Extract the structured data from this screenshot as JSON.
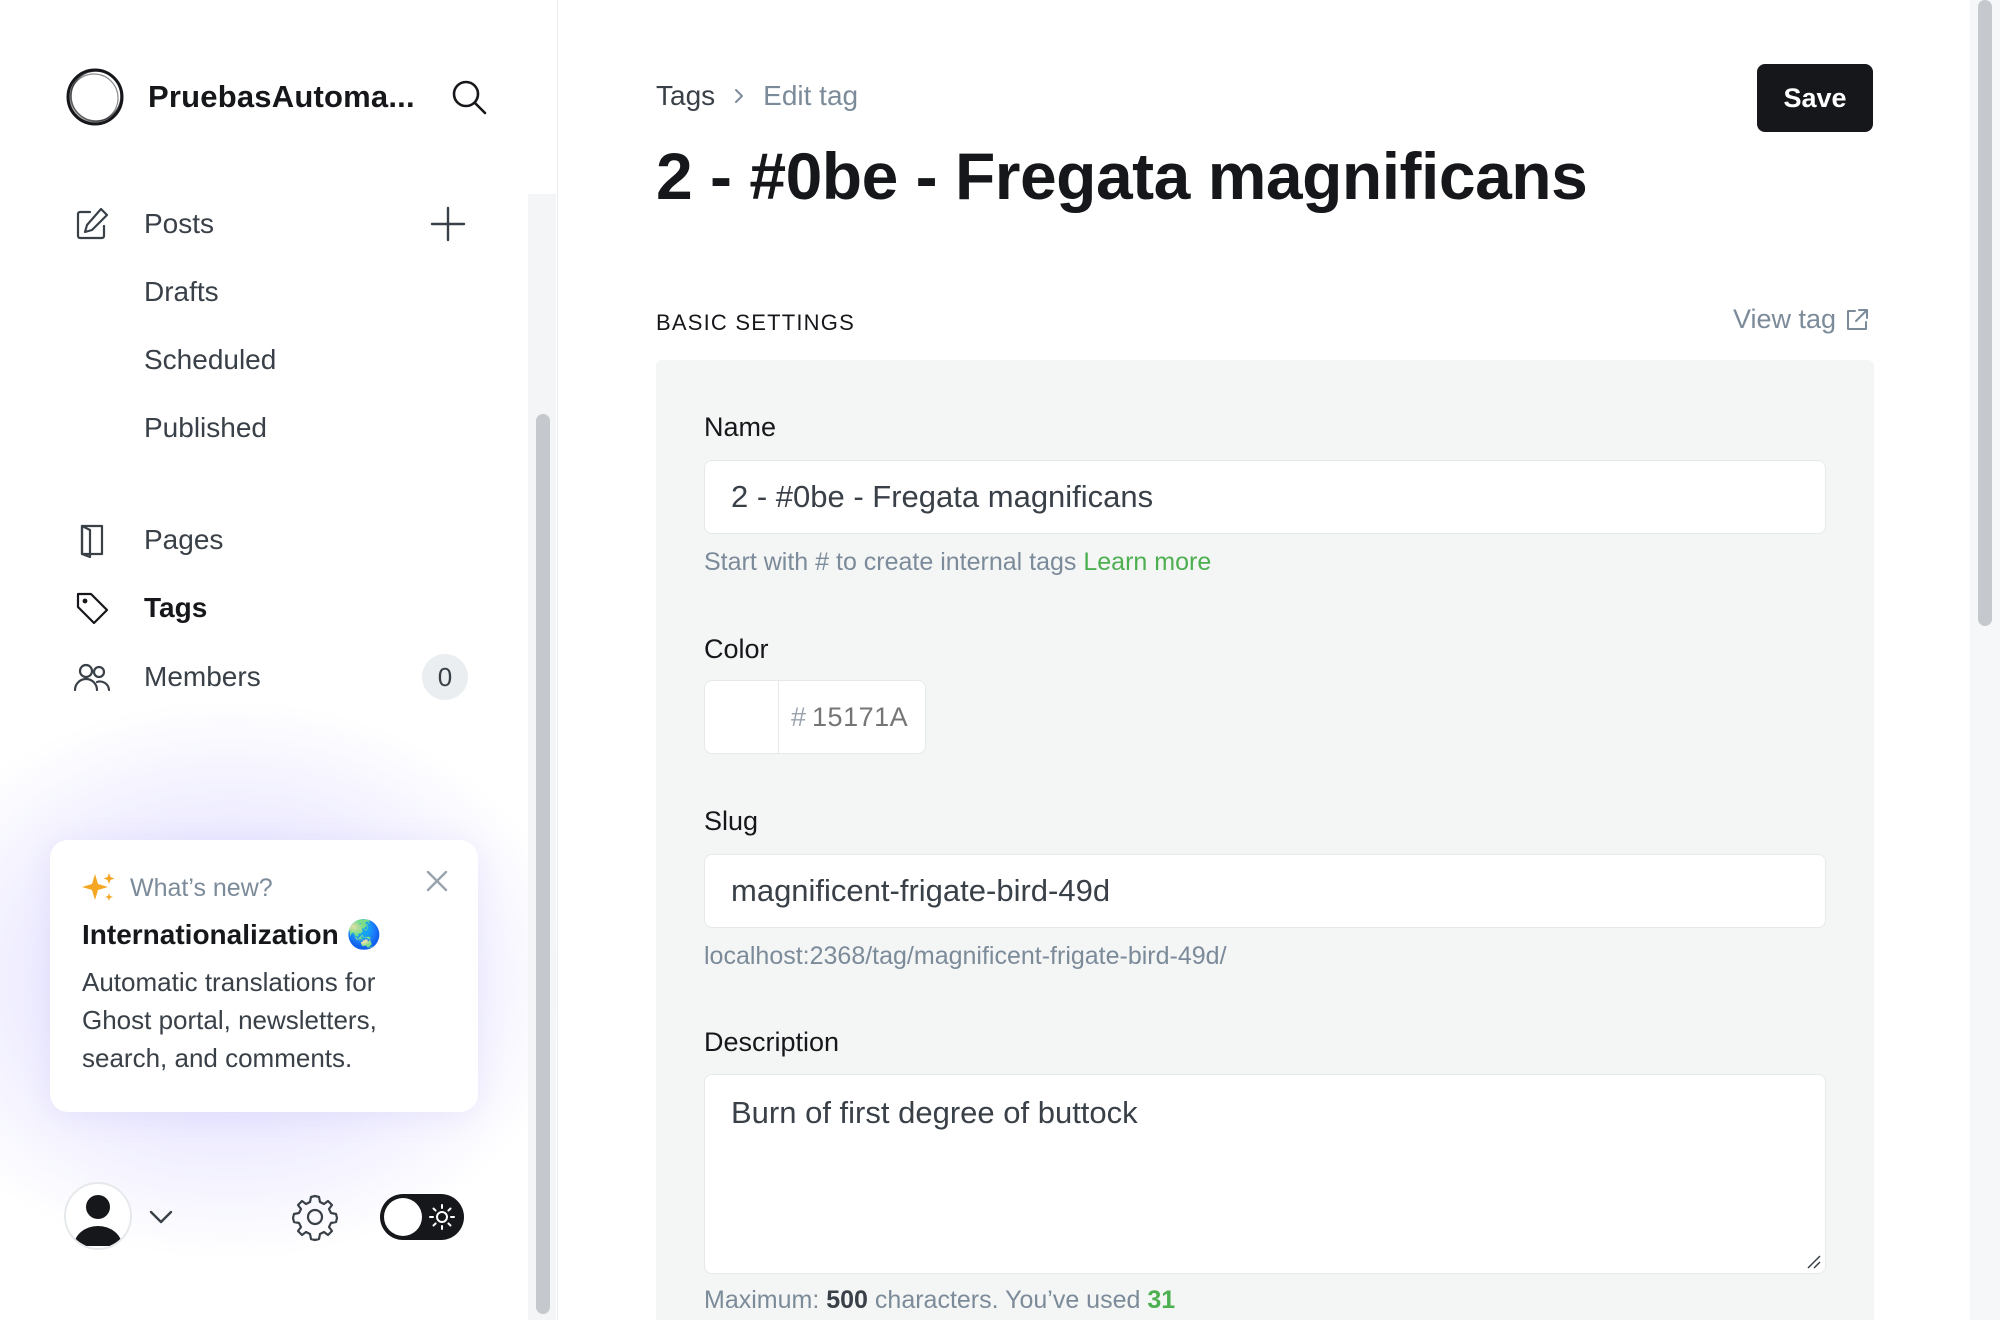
{
  "sidebar": {
    "site_title": "PruebasAutoma...",
    "nav": {
      "posts": "Posts",
      "drafts": "Drafts",
      "scheduled": "Scheduled",
      "published": "Published",
      "pages": "Pages",
      "tags": "Tags",
      "members": "Members",
      "members_count": "0"
    },
    "whats_new": {
      "kicker": "What’s new?",
      "title": "Internationalization 🌏",
      "body": "Automatic translations for Ghost portal, newsletters, search, and comments."
    }
  },
  "header": {
    "breadcrumb_parent": "Tags",
    "breadcrumb_current": "Edit tag",
    "save_label": "Save",
    "title": "2 - #0be - Fregata magnificans"
  },
  "basic_settings": {
    "section_label": "BASIC SETTINGS",
    "view_tag": "View tag",
    "name_label": "Name",
    "name_value": "2 - #0be - Fregata magnificans",
    "name_hint": "Start with # to create internal tags",
    "name_hint_link": "Learn more",
    "color_label": "Color",
    "color_hash": "#",
    "color_value": "15171A",
    "slug_label": "Slug",
    "slug_value": "magnificent-frigate-bird-49d",
    "slug_url": "localhost:2368/tag/magnificent-frigate-bird-49d/",
    "description_label": "Description",
    "description_value": "Burn of first degree of buttock",
    "max_prefix": "Maximum:",
    "max_value": "500",
    "used_prefix": "characters. You’ve used",
    "used_value": "31"
  },
  "colors": {
    "accent_green": "#4caf50",
    "text_dark": "#15171a",
    "muted": "#7c8b9a",
    "panel_bg": "#f4f5f5"
  },
  "icons": [
    "ghost-logo-icon",
    "search-icon",
    "edit-icon",
    "plus-icon",
    "page-icon",
    "tag-icon",
    "members-icon",
    "sparkle-icon",
    "close-icon",
    "chevron-down-icon",
    "gear-icon",
    "sun-icon",
    "external-link-icon",
    "chevron-right-icon"
  ]
}
